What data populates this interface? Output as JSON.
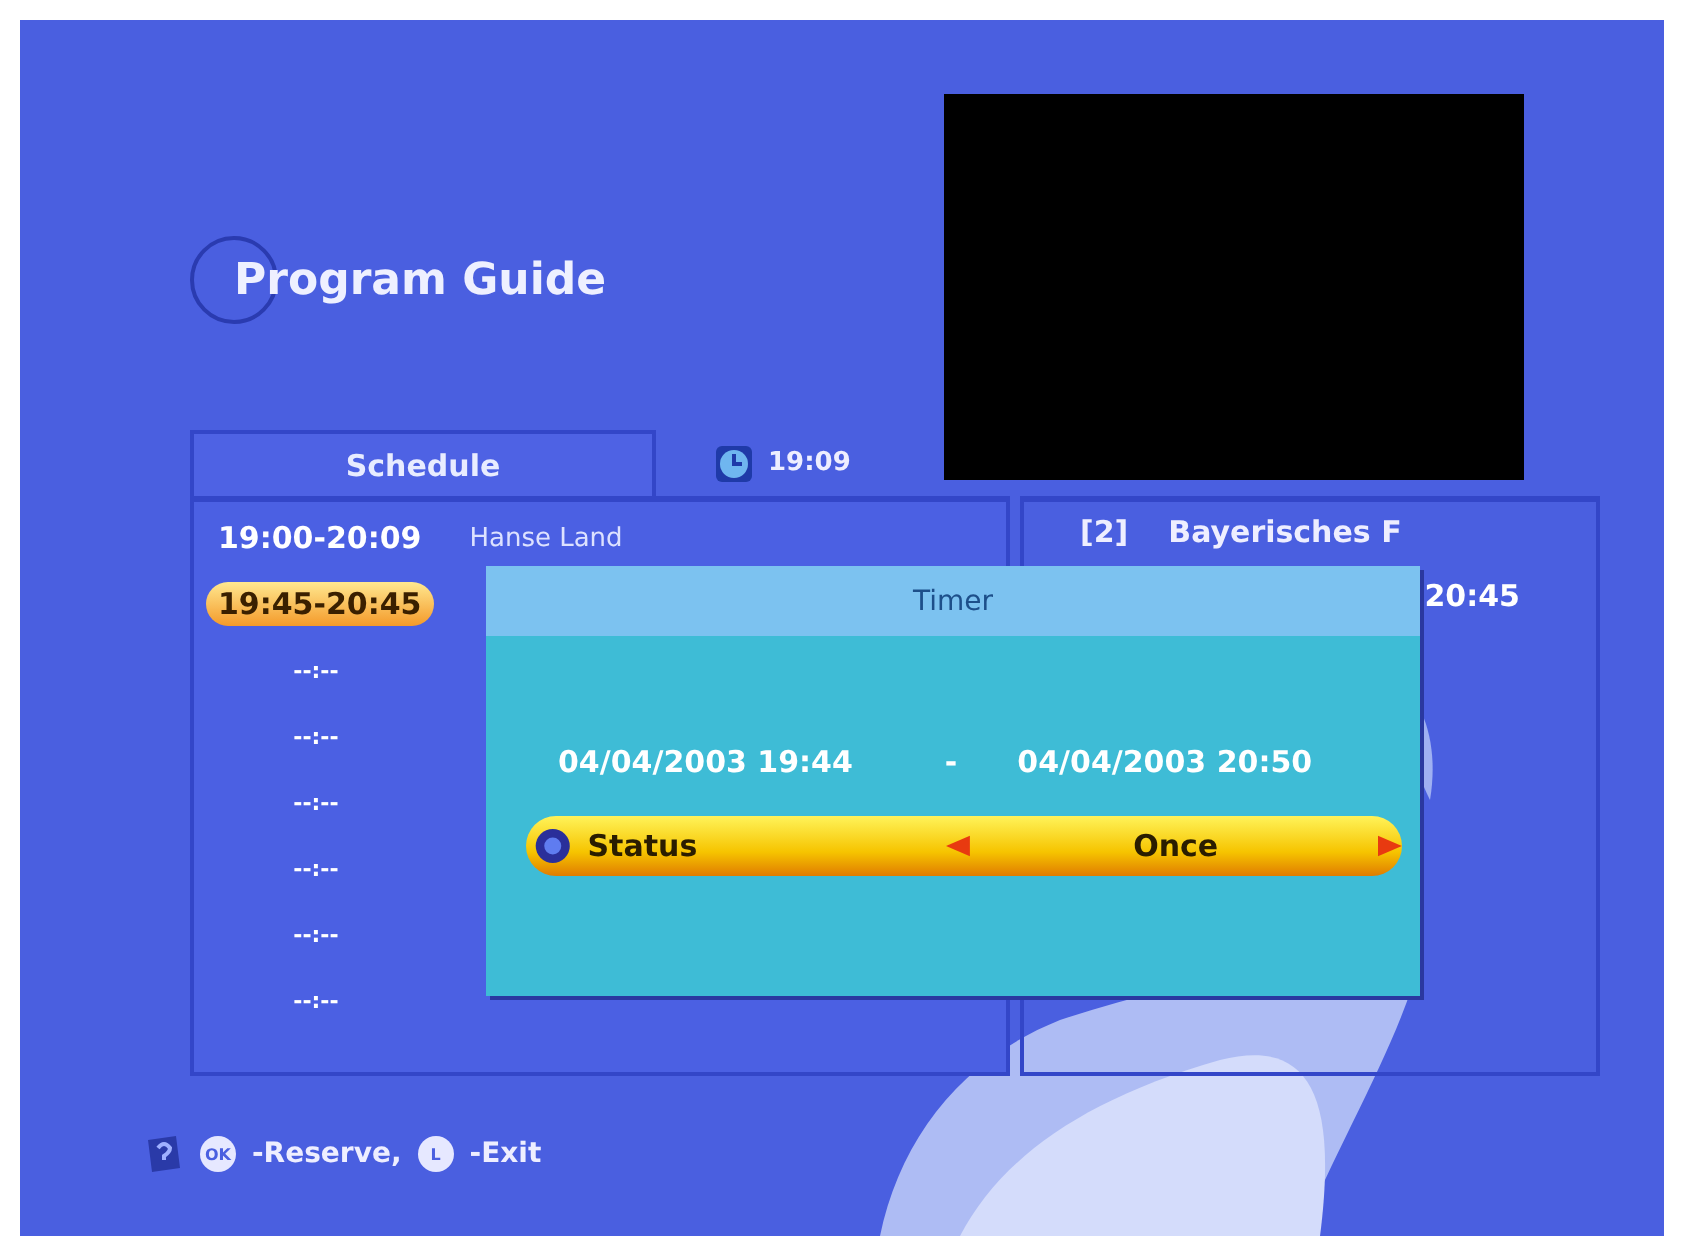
{
  "title": "Program Guide",
  "schedule_tab": "Schedule",
  "clock_time": "19:09",
  "schedule": [
    {
      "time": "19:00-20:09",
      "title": "Hanse Land",
      "selected": false
    },
    {
      "time": "19:45-20:45",
      "selected": true
    },
    {
      "time": "--:--",
      "selected": false
    },
    {
      "time": "--:--",
      "selected": false
    },
    {
      "time": "--:--",
      "selected": false
    },
    {
      "time": "--:--",
      "selected": false
    },
    {
      "time": "--:--",
      "selected": false
    },
    {
      "time": "--:--",
      "selected": false
    }
  ],
  "channel": {
    "number": "[2]",
    "name": "Bayerisches F",
    "time": "20:45"
  },
  "timer": {
    "title": "Timer",
    "start": "04/04/2003 19:44",
    "separator": "-",
    "end": "04/04/2003 20:50",
    "field": {
      "label": "Status",
      "value": "Once"
    }
  },
  "footer": [
    {
      "key": "OK",
      "text": "-Reserve,"
    },
    {
      "key": "L",
      "text": "-Exit"
    }
  ]
}
